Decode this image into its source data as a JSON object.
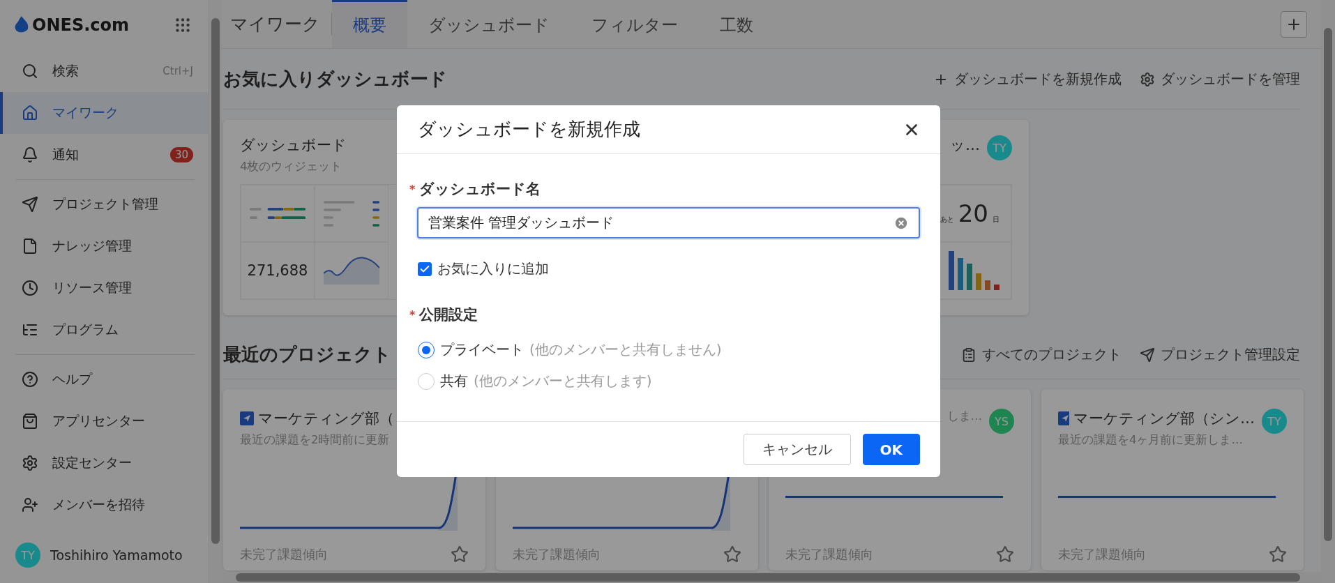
{
  "sidebar": {
    "logo": "ONES.com",
    "groups": [
      [
        {
          "label": "検索",
          "shortcut": "Ctrl+J",
          "selected": false
        },
        {
          "label": "マイワーク",
          "selected": true
        },
        {
          "label": "通知",
          "badge": "30",
          "selected": false
        }
      ],
      [
        {
          "label": "プロジェクト管理",
          "selected": false
        },
        {
          "label": "ナレッジ管理",
          "selected": false
        },
        {
          "label": "リソース管理",
          "selected": false
        },
        {
          "label": "プログラム",
          "selected": false
        }
      ],
      [
        {
          "label": "ヘルプ",
          "selected": false
        },
        {
          "label": "アプリセンター",
          "selected": false
        },
        {
          "label": "設定センター",
          "selected": false
        },
        {
          "label": "メンバーを招待",
          "selected": false
        }
      ]
    ],
    "user": {
      "initials": "TY",
      "name": "Toshihiro Yamamoto",
      "color": "#1a8a8c"
    }
  },
  "tabs": {
    "title": "マイワーク",
    "items": [
      {
        "label": "概要",
        "selected": true
      },
      {
        "label": "ダッシュボード",
        "selected": false
      },
      {
        "label": "フィルター",
        "selected": false
      },
      {
        "label": "工数",
        "selected": false
      }
    ]
  },
  "favorites": {
    "title": "お気に入りダッシュボード",
    "actions": [
      "ダッシュボードを新規作成",
      "ダッシュボードを管理"
    ],
    "cards": [
      {
        "kind": "summary",
        "title": "ダッシュボード",
        "subtitle": "4枚のウィジェット",
        "metric": "271,688"
      },
      {
        "kind": "countdown",
        "title": "ッ…",
        "avatar": {
          "initials": "TY",
          "color": "#1a8a8c"
        },
        "prefix": "あと",
        "count": "20",
        "unit": "日"
      }
    ]
  },
  "recent": {
    "title": "最近のプロジェクト",
    "actions": [
      "すべてのプロジェクト",
      "プロジェクト管理設定"
    ],
    "cards": [
      {
        "kind": "rising",
        "title": "マーケティング部（",
        "subtitle": "最近の課題を2時間前に更新",
        "footer": "未完了課題傾向"
      },
      {
        "kind": "rising",
        "footer": "未完了課題傾向"
      },
      {
        "kind": "flat",
        "subtitle": "しま…",
        "avatar": {
          "initials": "YS",
          "color": "#1e8450"
        },
        "footer": "未完了課題傾向"
      },
      {
        "kind": "flat",
        "title": "マーケティング部（シン…",
        "subtitle": "最近の課題を4ヶ月前に更新しま…",
        "avatar": {
          "initials": "TY",
          "color": "#1a8a8c"
        },
        "footer": "未完了課題傾向"
      }
    ]
  },
  "dialog": {
    "title": "ダッシュボードを新規作成",
    "name_field": {
      "marker": "*",
      "label": "ダッシュボード名",
      "value": "営業案件 管理ダッシュボード"
    },
    "favorite": {
      "label": "お気に入りに追加",
      "checked": true
    },
    "visibility": {
      "marker": "*",
      "label": "公開設定",
      "options": [
        {
          "label": "プライベート",
          "note": "(他のメンバーと共有しません)",
          "selected": true
        },
        {
          "label": "共有",
          "note": "(他のメンバーと共有します)",
          "selected": false
        }
      ]
    },
    "buttons": [
      {
        "label": "キャンセル",
        "kind": "secondary"
      },
      {
        "label": "OK",
        "kind": "primary"
      }
    ]
  }
}
